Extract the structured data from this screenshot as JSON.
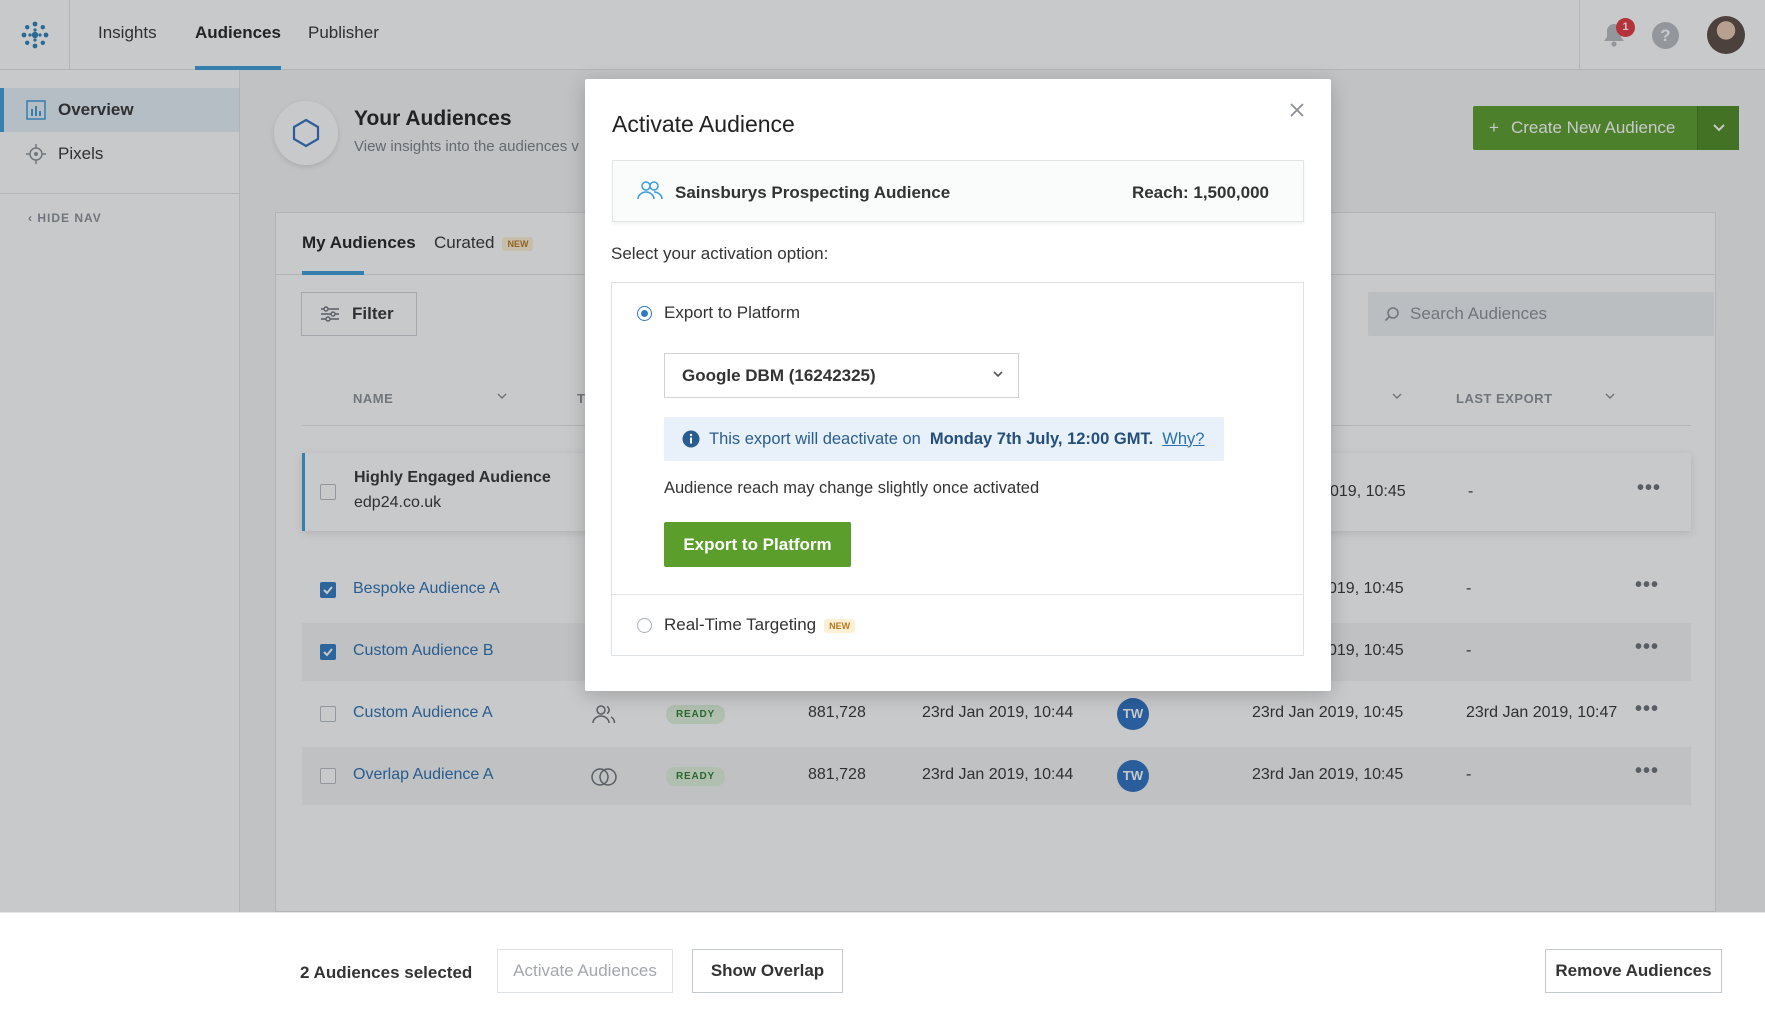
{
  "nav": {
    "links": [
      "Insights",
      "Audiences",
      "Publisher"
    ],
    "notification_count": "1",
    "help_label": "?"
  },
  "sidebar": {
    "items": [
      "Overview",
      "Pixels"
    ],
    "hide_nav": "HIDE NAV"
  },
  "page": {
    "title": "Your Audiences",
    "subtitle": "View insights into the audiences v",
    "create_button": "Create New Audience"
  },
  "tabs": {
    "my_audiences": "My Audiences",
    "curated": "Curated",
    "new_tag": "NEW"
  },
  "toolbar": {
    "filter_label": "Filter",
    "search_placeholder": "Search Audiences"
  },
  "table": {
    "headers": {
      "name": "NAME",
      "type_partial": "T",
      "last_export": "LAST EXPORT"
    },
    "rows": [
      {
        "name": "Highly Engaged Audience",
        "domain": "edp24.co.uk",
        "updated": "019, 10:45",
        "last_export": "-",
        "checked": false
      },
      {
        "name": "Bespoke Audience A",
        "updated": "019, 10:45",
        "last_export": "-",
        "checked": true
      },
      {
        "name": "Custom Audience B",
        "updated": "019, 10:45",
        "last_export": "-",
        "checked": true
      },
      {
        "name": "Custom Audience A",
        "status": "READY",
        "reach": "881,728",
        "created": "23rd Jan 2019, 10:44",
        "owner": "TW",
        "updated": "23rd Jan 2019, 10:45",
        "last_export": "23rd Jan 2019, 10:47",
        "checked": false
      },
      {
        "name": "Overlap Audience A",
        "status": "READY",
        "reach": "881,728",
        "created": "23rd Jan 2019, 10:44",
        "owner": "TW",
        "updated": "23rd Jan 2019, 10:45",
        "last_export": "-",
        "checked": false
      }
    ],
    "more_label": "•••"
  },
  "bottom_bar": {
    "selected_text": "2 Audiences selected",
    "activate": "Activate Audiences",
    "overlap": "Show Overlap",
    "remove": "Remove Audiences"
  },
  "modal": {
    "title": "Activate Audience",
    "audience_name": "Sainsburys Prospecting Audience",
    "reach": "Reach: 1,500,000",
    "select_label": "Select your activation option:",
    "option_export": "Export to Platform",
    "platform_selected": "Google DBM (16242325)",
    "info_prefix": "This export will deactivate on",
    "info_date": "Monday 7th July, 12:00 GMT.",
    "info_link": "Why?",
    "reach_note": "Audience reach may change slightly once activated",
    "export_button": "Export to Platform",
    "option_rtt": "Real-Time Targeting",
    "new_tag": "NEW"
  },
  "colors": {
    "accent_blue": "#3b9cd9",
    "brand_green": "#5b9e2b",
    "link_blue": "#2a6fb0",
    "alert_red": "#e5363e"
  }
}
